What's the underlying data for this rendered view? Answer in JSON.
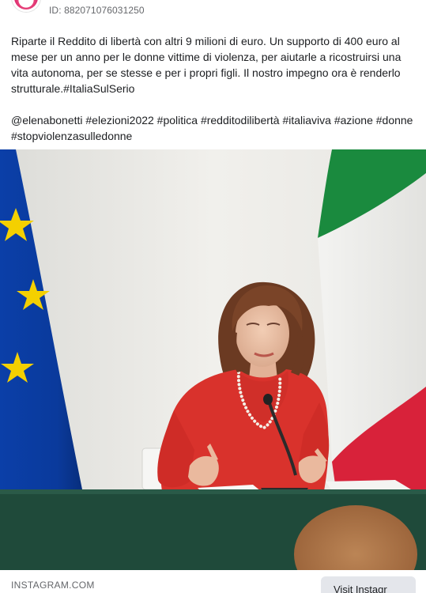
{
  "ad": {
    "id_text": "ID: 882071076031250"
  },
  "post": {
    "body": "Riparte il Reddito di libertà con altri 9 milioni di euro. Un supporto di 400 euro al mese per un anno per le donne vittime di violenza, per aiutarle a ricostruirsi una vita autonoma, per se stesse e per i propri figli. Il nostro impegno ora è renderlo strutturale.#ItaliaSulSerio",
    "hashtags": "@elenabonetti #elezioni2022 #politica #redditodilibertà #italiaviva #azione #donne #stopviolenzasulledonne"
  },
  "link": {
    "domain": "INSTAGRAM.COM",
    "cta_label": "Visit Instagr"
  },
  "colors": {
    "eu_blue": "#0a3a9c",
    "eu_star": "#f4d000",
    "flag_green": "#1a8a3e",
    "flag_red": "#d8223a",
    "dress_red": "#d9322c",
    "table_green": "#1f4a3a"
  }
}
